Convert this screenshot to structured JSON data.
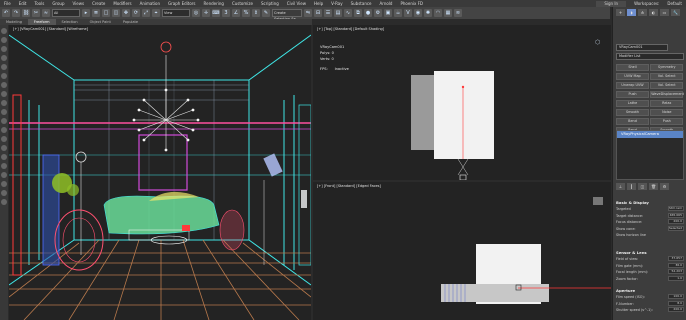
{
  "menu": {
    "items": [
      "File",
      "Edit",
      "Tools",
      "Group",
      "Views",
      "Create",
      "Modifiers",
      "Animation",
      "Graph Editors",
      "Rendering",
      "Customize",
      "Scripting",
      "Civil View",
      "Help",
      "V-Ray",
      "Substance",
      "Arnold",
      "Phoenix FD"
    ],
    "sign_in": "Sign In",
    "workspaces_label": "Workspaces:",
    "workspace": "Default"
  },
  "toolbar": {
    "selection_filter": "All",
    "create_selection_set": "Create Selection Se"
  },
  "tabs": [
    "Modeling",
    "Freeform",
    "Selection",
    "Object Paint",
    "Populate"
  ],
  "viewports": {
    "perspective_label": "[+] [VRayCam001] [Standard] [Wireframe]",
    "top_label": "[+] [Top] [Standard] [Default Shading]",
    "front_label": "[+] [Front] [Standard] [Edged Faces]"
  },
  "stats": {
    "object": "VRayCam001",
    "polys_label": "Polys:",
    "polys_value": "0",
    "verts_label": "Verts:",
    "verts_value": "0",
    "fps_label": "FPS:",
    "fps_value": "Inactive"
  },
  "command_panel": {
    "object_name": "VRayCam001",
    "modifier_list": "Modifier List",
    "buttons": [
      [
        "Shell",
        "Symmetry"
      ],
      [
        "UVW Map",
        "Vol. Select"
      ],
      [
        "Unwrap UVW",
        "Vol. Select"
      ],
      [
        "Push",
        "WaveDisplacement"
      ],
      [
        "Lathe",
        "Relax"
      ],
      [
        "Smooth",
        "Noise"
      ],
      [
        "Bend",
        "Push"
      ],
      [
        "Bend",
        "Smooth"
      ]
    ],
    "stack_item": "VRayPhysicalCamera",
    "basic_display_title": "Basic & Display",
    "targeted_label": "Targeted",
    "targeted_value": "Still cam",
    "target_distance_label": "Target distance:",
    "target_distance_value": "465.065",
    "focus_distance_label": "Focus distance:",
    "focus_distance_value": "200.0",
    "show_cone_label": "Show cone:",
    "show_cone_value": "Selected",
    "show_horizon_label": "Show horizon line",
    "sensor_lens_title": "Sensor & Lens",
    "fov_label": "Field of view:",
    "fov_value": "37.657",
    "film_gate_label": "Film gate (mm):",
    "film_gate_value": "36.0",
    "focal_length_label": "Focal length (mm):",
    "focal_length_value": "52.203",
    "zoom_factor_label": "Zoom factor:",
    "zoom_factor_value": "1.0",
    "aperture_title": "Aperture",
    "film_speed_label": "Film speed (ISO):",
    "film_speed_value": "100.0",
    "fnumber_label": "F-Number:",
    "fnumber_value": "8.0",
    "shutter_label": "Shutter speed (s^-1):",
    "shutter_value": "200.0"
  },
  "colors": {
    "stack_highlight": "#5a84c6",
    "wire_cyan": "#3fe6e6",
    "wire_pink": "#ff4fa0",
    "wire_magenta": "#d04bd8",
    "wire_blue": "#4f6bff"
  }
}
